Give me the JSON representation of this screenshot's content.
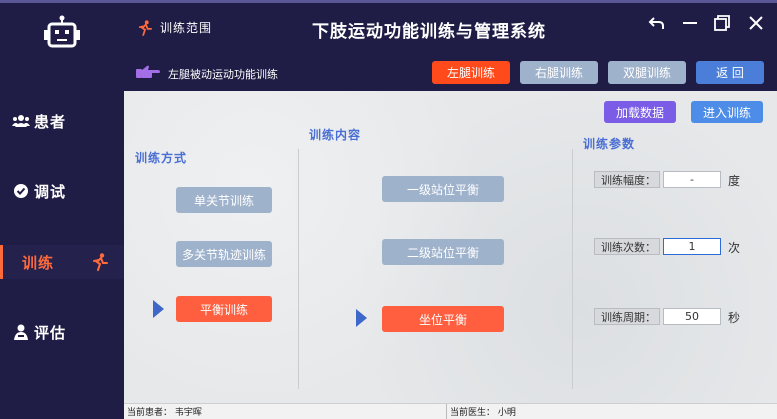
{
  "app": {
    "title": "下肢运动功能训练与管理系统",
    "scope_label": "训练范围"
  },
  "sidebar": {
    "items": [
      {
        "label": "患者",
        "icon": "users-icon"
      },
      {
        "label": "调试",
        "icon": "check-circle-icon"
      },
      {
        "label": "训练",
        "icon": "running-icon",
        "active": true
      },
      {
        "label": "评估",
        "icon": "assess-user-icon"
      }
    ]
  },
  "subheader": {
    "title": "左腿被动运动功能训练",
    "tabs": [
      {
        "label": "左腿训练",
        "active": true
      },
      {
        "label": "右腿训练"
      },
      {
        "label": "双腿训练"
      },
      {
        "label": "返 回"
      }
    ]
  },
  "main": {
    "load_button": "加载数据",
    "enter_button": "进入训练",
    "mode": {
      "title": "训练方式",
      "options": [
        "单关节训练",
        "多关节轨迹训练",
        "平衡训练"
      ],
      "selected": 2
    },
    "content": {
      "title": "训练内容",
      "options": [
        "一级站位平衡",
        "二级站位平衡",
        "坐位平衡"
      ],
      "selected": 2
    },
    "params": {
      "title": "训练参数",
      "rows": [
        {
          "label": "训练幅度：",
          "value": "-",
          "unit": "度"
        },
        {
          "label": "训练次数：",
          "value": "1",
          "unit": "次"
        },
        {
          "label": "训练周期：",
          "value": "50",
          "unit": "秒"
        }
      ]
    }
  },
  "status": {
    "patient": "当前患者：  韦宇晖",
    "doctor": "当前医生：  小明"
  },
  "colors": {
    "accent": "#ff5e3f",
    "primary": "#1f1d45",
    "blue": "#4a6ed3"
  }
}
